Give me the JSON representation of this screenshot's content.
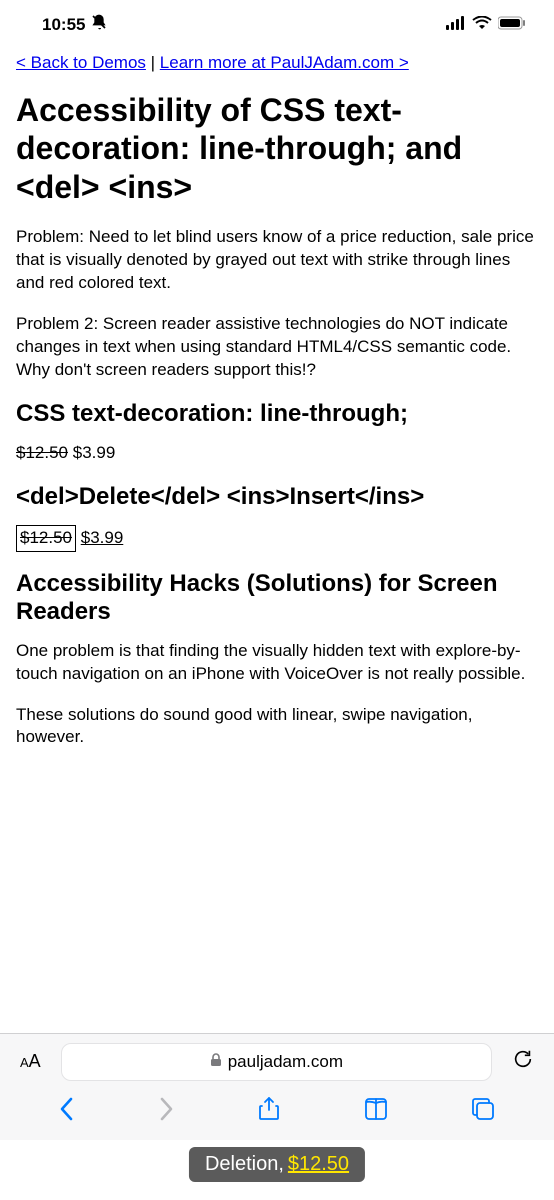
{
  "status": {
    "time": "10:55"
  },
  "nav": {
    "back": "< Back to Demos",
    "separator": " | ",
    "learn": "Learn more at PaulJAdam.com >"
  },
  "h1": "Accessibility of CSS text-decoration: line-through; and <del> <ins>",
  "p1": "Problem: Need to let blind users know of a price reduction, sale price that is visually denoted by grayed out text with strike through lines and red colored text.",
  "p2": "Problem 2: Screen reader assistive technologies do NOT indicate changes in text when using standard HTML4/CSS semantic code. Why don't screen readers support this!?",
  "h2a": "CSS text-decoration: line-through;",
  "price1_old": "$12.50",
  "price1_new": "$3.99",
  "h2b": "<del>Delete</del> <ins>Insert</ins>",
  "price2_old": "$12.50",
  "price2_new": "$3.99",
  "h2c": "Accessibility Hacks (Solutions) for Screen Readers",
  "p3": "One problem is that finding the visually hidden text with explore-by-touch navigation on an iPhone with VoiceOver is not really possible.",
  "p4": "These solutions do sound good with linear, swipe navigation, however.",
  "browser": {
    "aa": "AA",
    "domain": "pauljadam.com"
  },
  "caption": {
    "prefix": "Deletion, ",
    "value": "$12.50"
  }
}
